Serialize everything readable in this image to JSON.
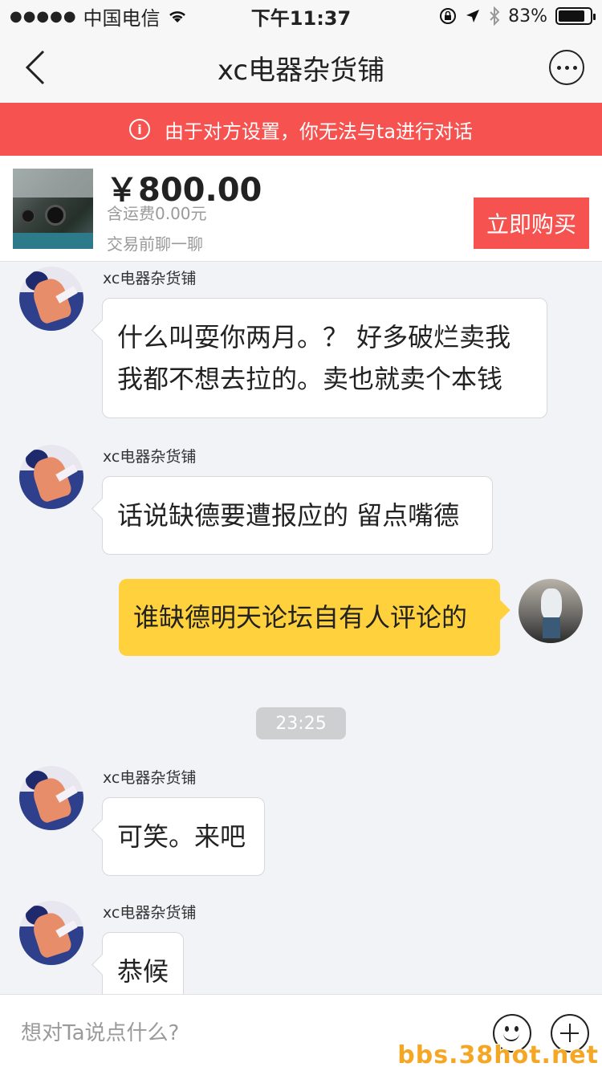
{
  "status_bar": {
    "signal": "●●●●●",
    "carrier": "中国电信",
    "time": "下午11:37",
    "battery_text": "83%",
    "battery_level": 0.83
  },
  "nav": {
    "title": "xc电器杂货铺"
  },
  "banner": {
    "icon": "i",
    "text": "由于对方设置，你无法与ta进行对话"
  },
  "product": {
    "price": "￥800.00",
    "shipping": "含运费0.00元",
    "hint": "交易前聊一聊",
    "buy_label": "立即购买"
  },
  "messages": [
    {
      "sender": "xc电器杂货铺",
      "lines": [
        "什么叫耍你两月。？ 好多破烂卖我",
        "我都不想去拉的。卖也就卖个本钱"
      ]
    },
    {
      "sender": "xc电器杂货铺",
      "lines": [
        "话说缺德要遭报应的 留点嘴德"
      ]
    },
    {
      "sender": "me",
      "lines": [
        "谁缺德明天论坛自有人评论的"
      ]
    },
    {
      "time": "23:25"
    },
    {
      "sender": "xc电器杂货铺",
      "lines": [
        "可笑。来吧"
      ]
    },
    {
      "sender": "xc电器杂货铺",
      "lines": [
        "恭候"
      ]
    }
  ],
  "input": {
    "placeholder": "想对Ta说点什么?"
  },
  "watermark": "bbs.38hot.net"
}
